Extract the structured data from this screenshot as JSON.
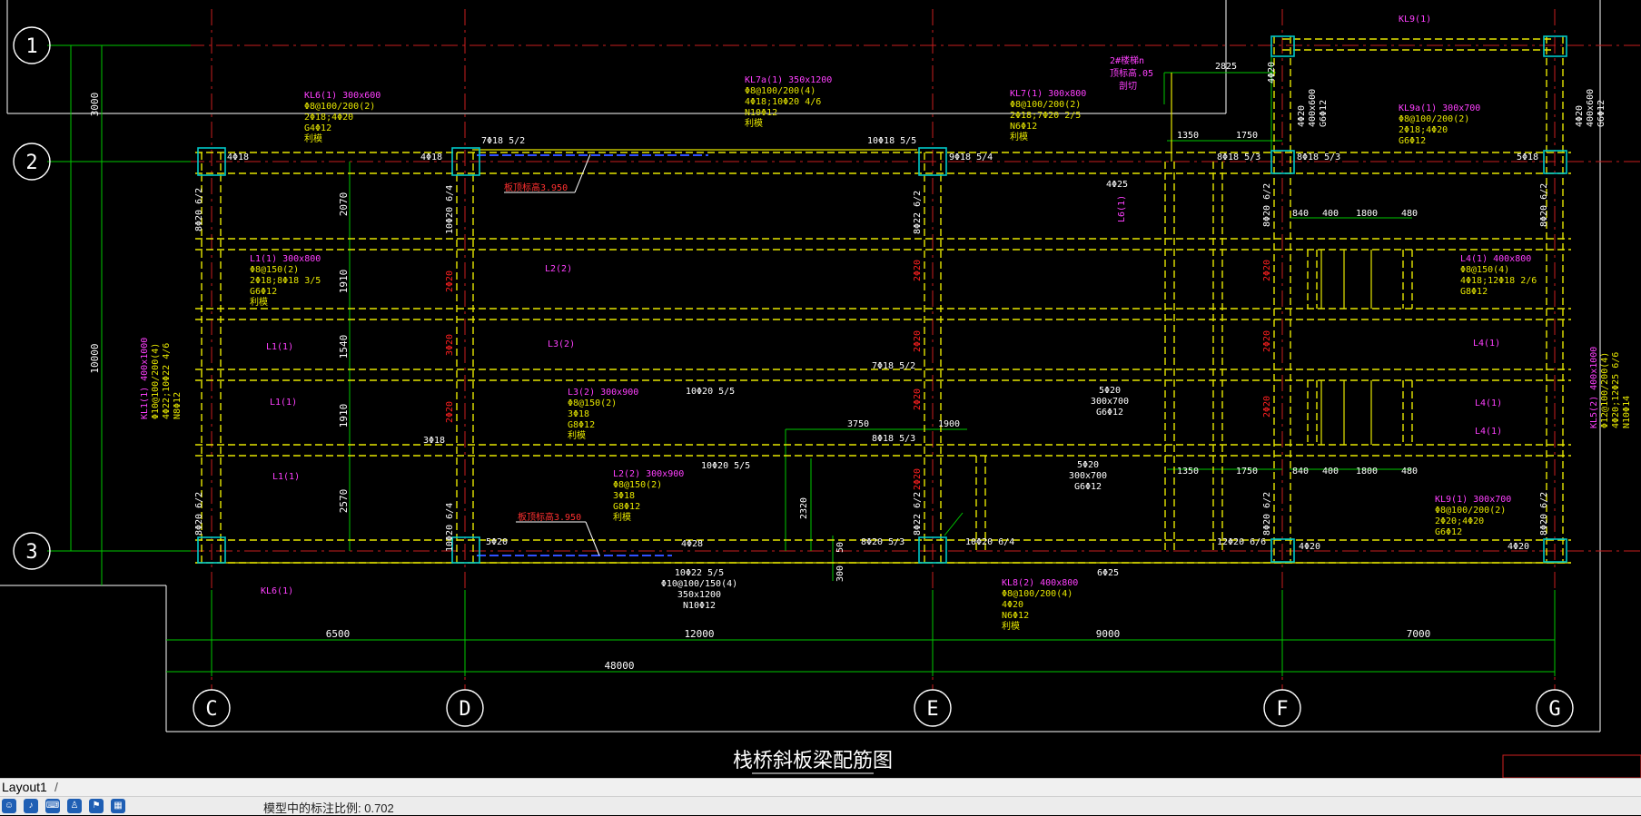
{
  "drawing": {
    "title": "栈桥斜板梁配筋图",
    "axes_numbers": [
      "1",
      "2",
      "3"
    ],
    "axes_letters": [
      "C",
      "D",
      "E",
      "F",
      "G"
    ],
    "spans": [
      "6500",
      "12000",
      "9000",
      "7000"
    ],
    "total": "48000",
    "left_dims": [
      "3000",
      "10000"
    ],
    "vert_dims": [
      "2070",
      "1910",
      "1540",
      "1910",
      "2570"
    ],
    "labels": {
      "kl6_1": [
        "KL6(1) 300x600",
        "Φ8@100/200(2)",
        "2Φ18;4Φ20",
        "G4Φ12",
        "利模"
      ],
      "kl7a": [
        "KL7a(1) 350x1200",
        "Φ8@100/200(4)",
        "4Φ18;10Φ20 4/6",
        "N10Φ12",
        "利模"
      ],
      "kl7": [
        "KL7(1) 300x800",
        "Φ8@100/200(2)",
        "2Φ18;7Φ20 2/5",
        "N6Φ12",
        "利模"
      ],
      "kl9a": [
        "KL9a(1) 300x700",
        "Φ8@100/200(2)",
        "2Φ18;4Φ20",
        "G6Φ12"
      ],
      "kl9_top": "KL9(1)",
      "l1_1": [
        "L1(1) 300x800",
        "Φ8@150(2)",
        "2Φ18;8Φ18 3/5",
        "G6Φ12",
        "利模"
      ],
      "l4_1": [
        "L4(1) 400x800",
        "Φ8@150(4)",
        "4Φ18;12Φ18 2/6",
        "G8Φ12"
      ],
      "l3_2": [
        "L3(2) 300x900",
        "Φ8@150(2)",
        "3Φ18",
        "G8Φ12",
        "利模"
      ],
      "l2_2": [
        "L2(2) 300x900",
        "Φ8@150(2)",
        "3Φ18",
        "G8Φ12",
        "利模"
      ],
      "kl9_1": [
        "KL9(1) 300x700",
        "Φ8@100/200(2)",
        "2Φ20;4Φ20",
        "G6Φ12"
      ],
      "kl8": [
        "KL8(2) 400x800",
        "Φ8@100/200(4)",
        "4Φ20",
        "N6Φ12",
        "利模"
      ],
      "bottom_mid": [
        "10Φ22 5/5",
        "Φ10@100/150(4)",
        "350x1200",
        "N10Φ12"
      ],
      "mid_center": [
        "5Φ20",
        "300x700",
        "G6Φ12"
      ],
      "mid_center2": [
        "5Φ20",
        "300x700",
        "G6Φ12"
      ],
      "kl1_left": [
        "KL1(1) 400x1000",
        "Φ10@100/200(4)",
        "4Φ22;10Φ22 4/6",
        "N8Φ12"
      ],
      "kl5_right": [
        "KL5(2) 400x1000",
        "Φ12@100/200(4)",
        "4Φ20;12Φ25 6/6",
        "N10Φ14"
      ],
      "right_col_top": [
        "4Φ20",
        "400x600",
        "G6Φ12"
      ],
      "right_col": [
        "4Φ20",
        "400x600",
        "G6Φ12"
      ],
      "slab_note": "板顶标高3.950",
      "slab_note2": "板顶标高3.950",
      "top_note": [
        "2#楼梯n",
        "顶标高.05",
        "剖切"
      ],
      "short": {
        "l2": "L2(2)",
        "l1a": "L1(1)",
        "l1b": "L1(1)",
        "l1c": "L1(1)",
        "l3": "L3(2)",
        "l4a": "L4(1)",
        "l4b": "L4(1)",
        "l4c": "L4(1)",
        "kl6b": "KL6(1)",
        "l6": "L6(1)"
      },
      "rebar": {
        "r1": "4Φ18",
        "r2": "4Φ18",
        "r3": "7Φ18 5/2",
        "r4": "10Φ18 5/5",
        "r5": "9Φ18 5/4",
        "r6": "8Φ18 5/3",
        "r7": "8Φ18 5/3",
        "r8": "5Φ18",
        "r9": "4Φ25",
        "r10": "7Φ18 5/2",
        "r11": "10Φ20 5/5",
        "r12": "10Φ20 5/5",
        "r13": "8Φ18 5/3",
        "r14": "4Φ28",
        "r15": "8Φ20 5/3",
        "r16": "10Φ20 6/4",
        "r17": "5Φ20",
        "r18": "6Φ25",
        "r19": "12Φ20 6/6",
        "r20": "4Φ20",
        "r21": "4Φ20",
        "r22": "3Φ18",
        "r23": "4Φ20",
        "d2825": "2825",
        "d1350": "1350",
        "d1750": "1750",
        "d840": "840",
        "d400": "400",
        "d1800": "1800",
        "d480": "480",
        "d3750": "3750",
        "d1900": "1900",
        "d2320": "2320",
        "d300": "300",
        "d50": "50",
        "d1350b": "1350",
        "d1750b": "1750",
        "d840b": "840",
        "d400b": "400",
        "d1800b": "1800",
        "d480b": "480"
      },
      "col_vert": {
        "c1": "8Φ20 6/2",
        "c2": "8Φ20 6/2",
        "c3": "10Φ20 6/4",
        "c4": "10Φ20 6/4",
        "c5": "8Φ22 6/2",
        "c6": "8Φ22 6/2",
        "c7": "8Φ20 6/2",
        "c8": "8Φ20 6/2",
        "c9": "8Φ20 6/2",
        "c10": "8Φ20 6/2"
      }
    }
  },
  "layout_tab": "Layout1",
  "status_message": "模型中的标注比例: 0.702",
  "colors": {
    "background": "#000000",
    "grid": "#00c800",
    "beam": "#ffff00",
    "column": "#00c8c8",
    "magenta": "#ff40ff",
    "red": "#ff2020",
    "dim": "#00ff00"
  }
}
